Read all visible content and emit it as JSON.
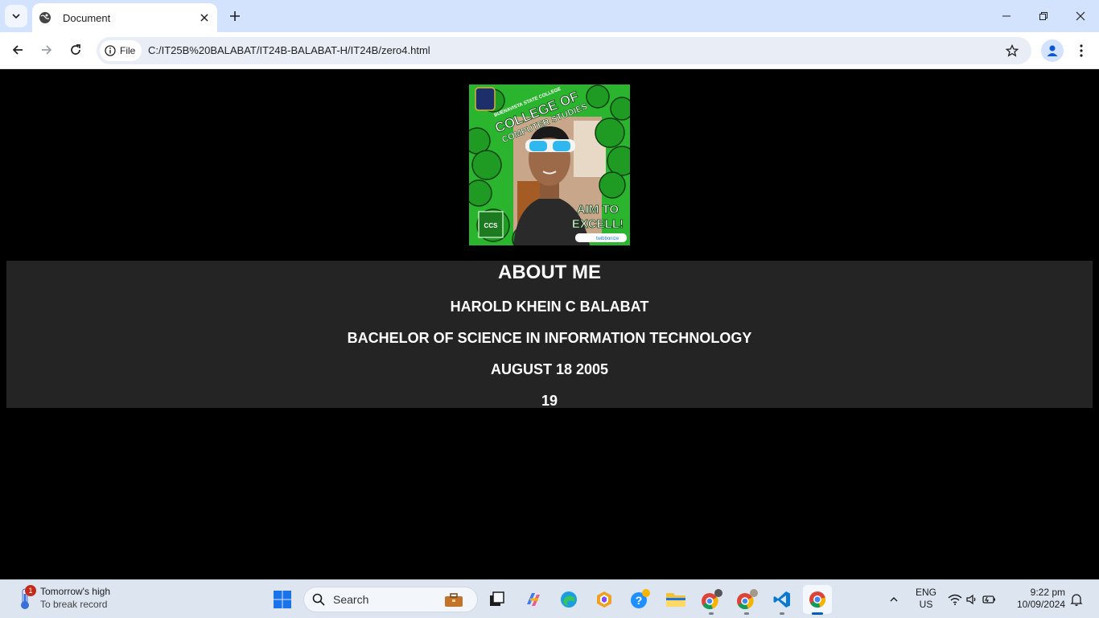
{
  "browser": {
    "tab_title": "Document",
    "address_scheme_label": "File",
    "url": "C:/IT25B%20BALABAT/IT24B-BALABAT-H/IT24B/zero4.html"
  },
  "page": {
    "photo": {
      "banner_line1": "BUENAVISTA STATE COLLEGE",
      "banner_line2": "COLLEGE OF",
      "banner_line3": "COMPUTER STUDIES",
      "slogan_line1": "AIM TO",
      "slogan_line2": "EXCELL!",
      "watermark": "twibbonize",
      "seal_text": "CCS"
    },
    "heading": "ABOUT ME",
    "name": "HAROLD KHEIN C BALABAT",
    "course": "BACHELOR OF SCIENCE IN INFORMATION TECHNOLOGY",
    "birthdate": "AUGUST 18 2005",
    "age": "19"
  },
  "taskbar": {
    "weather_title": "Tomorrow's high",
    "weather_subtitle": "To break record",
    "weather_badge": "1",
    "search_placeholder": "Search",
    "lang_line1": "ENG",
    "lang_line2": "US",
    "time": "9:22 pm",
    "date": "10/09/2024"
  },
  "colors": {
    "page_background": "#000000",
    "about_panel": "#242424",
    "tabbar": "#d3e3fd",
    "photo_green": "#2bb52f"
  }
}
